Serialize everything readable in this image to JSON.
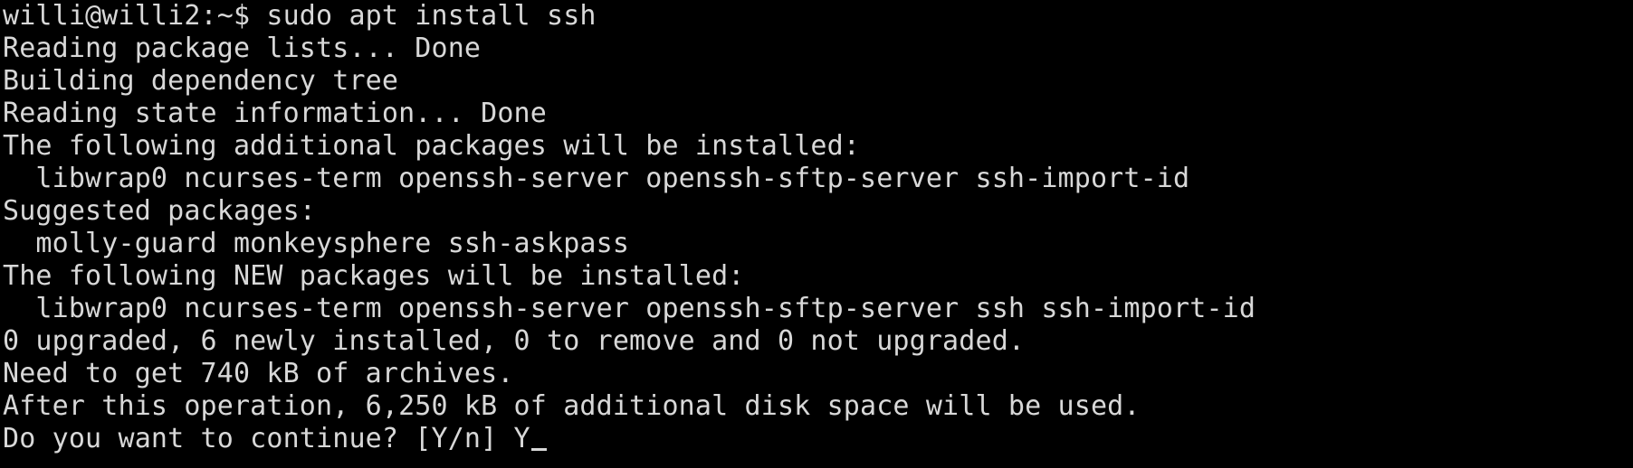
{
  "terminal": {
    "lines": [
      "willi@willi2:~$ sudo apt install ssh",
      "Reading package lists... Done",
      "Building dependency tree",
      "Reading state information... Done",
      "The following additional packages will be installed:",
      "  libwrap0 ncurses-term openssh-server openssh-sftp-server ssh-import-id",
      "Suggested packages:",
      "  molly-guard monkeysphere ssh-askpass",
      "The following NEW packages will be installed:",
      "  libwrap0 ncurses-term openssh-server openssh-sftp-server ssh ssh-import-id",
      "0 upgraded, 6 newly installed, 0 to remove and 0 not upgraded.",
      "Need to get 740 kB of archives.",
      "After this operation, 6,250 kB of additional disk space will be used.",
      "Do you want to continue? [Y/n] Y"
    ]
  }
}
